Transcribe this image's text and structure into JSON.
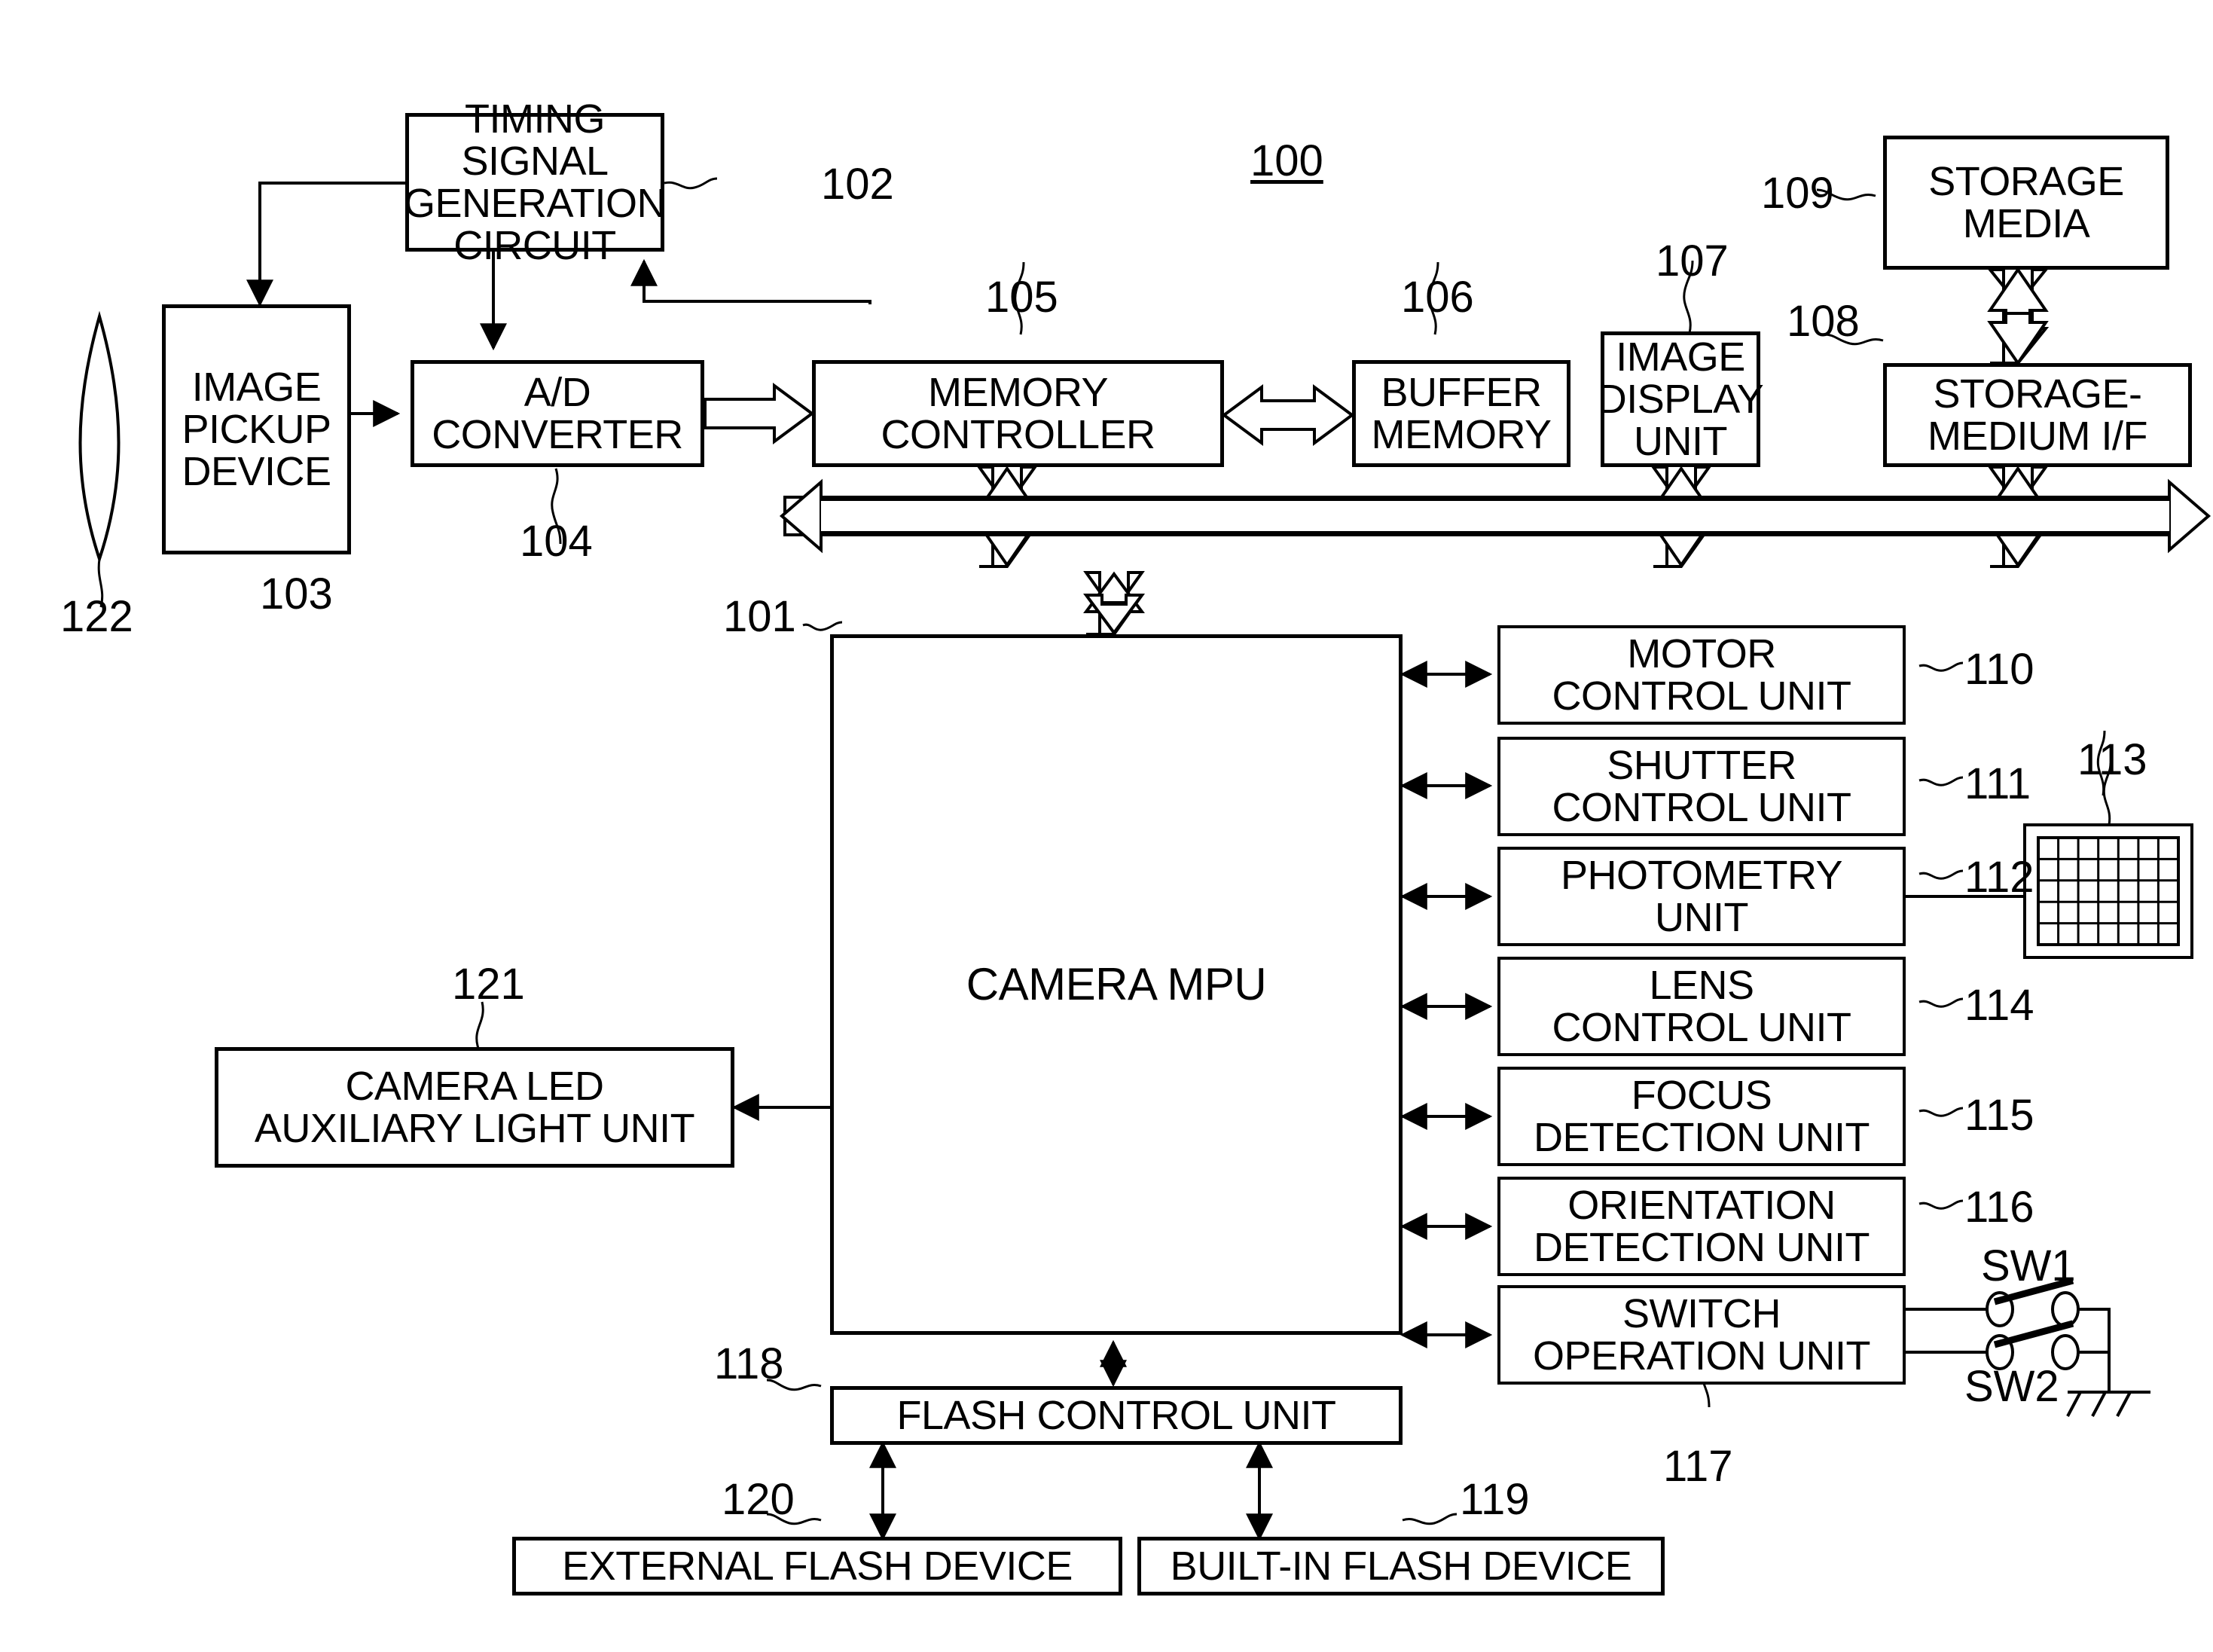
{
  "figure": {
    "system_ref": "100",
    "blocks": [
      {
        "id": "tsg",
        "label": "TIMING SIGNAL\nGENERATION\nCIRCUIT",
        "ref": "102"
      },
      {
        "id": "ipd",
        "label": "IMAGE\nPICKUP\nDEVICE",
        "ref": "103"
      },
      {
        "id": "adc",
        "label": "A/D\nCONVERTER",
        "ref": "104"
      },
      {
        "id": "memctl",
        "label": "MEMORY\nCONTROLLER",
        "ref": "105"
      },
      {
        "id": "bufmem",
        "label": "BUFFER\nMEMORY",
        "ref": "106"
      },
      {
        "id": "imgdisp",
        "label": "IMAGE\nDISPLAY\nUNIT",
        "ref": "107"
      },
      {
        "id": "stormedif",
        "label": "STORAGE-\nMEDIUM I/F",
        "ref": "108"
      },
      {
        "id": "stormedia",
        "label": "STORAGE\nMEDIA",
        "ref": "109"
      },
      {
        "id": "mpu",
        "label": "CAMERA MPU",
        "ref": "101"
      },
      {
        "id": "motor",
        "label": "MOTOR\nCONTROL UNIT",
        "ref": "110"
      },
      {
        "id": "shutter",
        "label": "SHUTTER\nCONTROL UNIT",
        "ref": "111"
      },
      {
        "id": "photometry",
        "label": "PHOTOMETRY\nUNIT",
        "ref": "112"
      },
      {
        "id": "lens_ctl",
        "label": "LENS\nCONTROL UNIT",
        "ref": "114"
      },
      {
        "id": "focus",
        "label": "FOCUS\nDETECTION UNIT",
        "ref": "115"
      },
      {
        "id": "orientation",
        "label": "ORIENTATION\nDETECTION UNIT",
        "ref": "116"
      },
      {
        "id": "switchop",
        "label": "SWITCH\nOPERATION UNIT",
        "ref": "117"
      },
      {
        "id": "camled",
        "label": "CAMERA LED\nAUXILIARY LIGHT UNIT",
        "ref": "121"
      },
      {
        "id": "flashctl",
        "label": "FLASH CONTROL UNIT",
        "ref": "118"
      },
      {
        "id": "extflash",
        "label": "EXTERNAL FLASH DEVICE",
        "ref": "120"
      },
      {
        "id": "bltflash",
        "label": "BUILT-IN FLASH DEVICE",
        "ref": "119"
      }
    ],
    "symbols": [
      {
        "id": "lens",
        "name": "taking-lens",
        "ref": "122"
      },
      {
        "id": "photosensor",
        "name": "photometry-sensor-grid",
        "ref": "113",
        "grid_cols": 7,
        "grid_rows": 5
      },
      {
        "id": "sw1",
        "name": "switch-sw1",
        "label": "SW1"
      },
      {
        "id": "sw2",
        "name": "switch-sw2",
        "label": "SW2"
      },
      {
        "id": "gnd",
        "name": "ground-symbol"
      }
    ],
    "refs": {
      "r100": "100",
      "r101": "101",
      "r102": "102",
      "r103": "103",
      "r104": "104",
      "r105": "105",
      "r106": "106",
      "r107": "107",
      "r108": "108",
      "r109": "109",
      "r110": "110",
      "r111": "111",
      "r112": "112",
      "r113": "113",
      "r114": "114",
      "r115": "115",
      "r116": "116",
      "r117": "117",
      "r118": "118",
      "r119": "119",
      "r120": "120",
      "r121": "121",
      "r122": "122"
    },
    "labels": {
      "sw1": "SW1",
      "sw2": "SW2"
    },
    "text": {
      "tsg": "TIMING SIGNAL\nGENERATION\nCIRCUIT",
      "ipd": "IMAGE\nPICKUP\nDEVICE",
      "adc": "A/D\nCONVERTER",
      "memctl": "MEMORY\nCONTROLLER",
      "bufmem": "BUFFER\nMEMORY",
      "imgdisp": "IMAGE\nDISPLAY\nUNIT",
      "stormedif": "STORAGE-\nMEDIUM I/F",
      "stormedia": "STORAGE\nMEDIA",
      "mpu": "CAMERA MPU",
      "motor": "MOTOR\nCONTROL UNIT",
      "shutter": "SHUTTER\nCONTROL UNIT",
      "photometry": "PHOTOMETRY\nUNIT",
      "lens_ctl": "LENS\nCONTROL UNIT",
      "focus": "FOCUS\nDETECTION UNIT",
      "orientation": "ORIENTATION\nDETECTION UNIT",
      "switchop": "SWITCH\nOPERATION UNIT",
      "camled": "CAMERA LED\nAUXILIARY LIGHT UNIT",
      "flashctl": "FLASH CONTROL UNIT",
      "extflash": "EXTERNAL FLASH DEVICE",
      "bltflash": "BUILT-IN FLASH DEVICE"
    },
    "colors": {
      "ink": "#000000",
      "paper": "#ffffff"
    }
  }
}
